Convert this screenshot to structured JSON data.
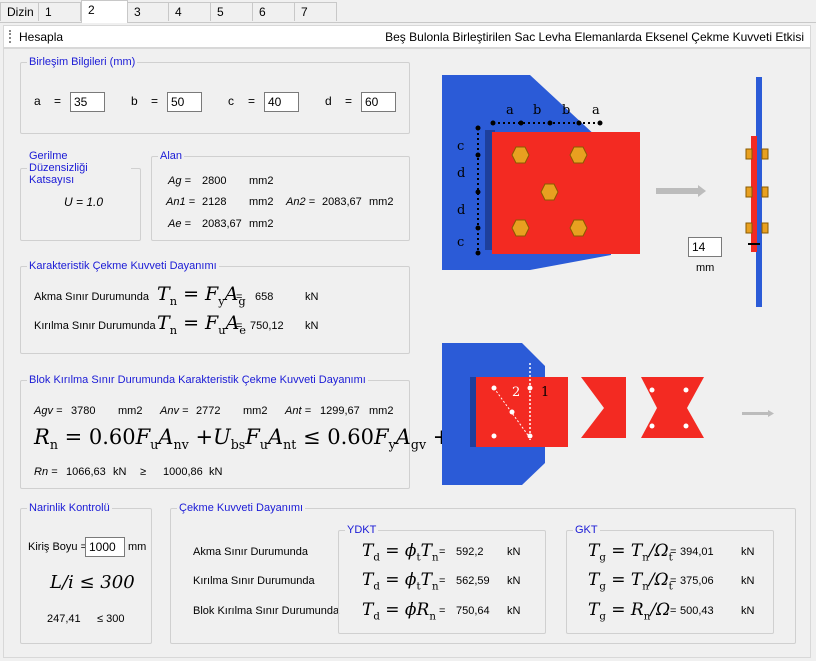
{
  "tabs": [
    "Dizin",
    "1",
    "2",
    "3",
    "4",
    "5",
    "6",
    "7"
  ],
  "toolbar": {
    "calc_label": "Hesapla",
    "title": "Beş Bulonla Birleştirilen Sac Levha Elemanlarda Eksenel Çekme Kuvveti Etkisi"
  },
  "connection": {
    "legend": "Birleşim Bilgileri (mm)",
    "a_label": "a",
    "a_value": "35",
    "b_label": "b",
    "b_value": "50",
    "c_label": "c",
    "c_value": "40",
    "d_label": "d",
    "d_value": "60",
    "eq": "="
  },
  "shearlag": {
    "legend": "Gerilme Düzensizliği Katsayısı",
    "u_text": "U = 1.0"
  },
  "area": {
    "legend": "Alan",
    "ag_label": "Ag =",
    "ag_value": "2800",
    "ag_unit": "mm2",
    "an1_label": "An1 =",
    "an1_value": "2128",
    "an1_unit": "mm2",
    "an2_label": "An2 =",
    "an2_value": "2083,67",
    "an2_unit": "mm2",
    "ae_label": "Ae =",
    "ae_value": "2083,67",
    "ae_unit": "mm2"
  },
  "nominal": {
    "legend": "Karakteristik Çekme Kuvveti Dayanımı",
    "yield_label": "Akma Sınır Durumunda",
    "yield_value": "658",
    "yield_unit": "kN",
    "rupture_label": "Kırılma Sınır Durumunda",
    "rupture_value": "750,12",
    "rupture_unit": "kN"
  },
  "block": {
    "legend": "Blok Kırılma Sınır Durumunda Karakteristik Çekme Kuvveti Dayanımı",
    "agv_label": "Agv =",
    "agv_value": "3780",
    "agv_unit": "mm2",
    "anv_label": "Anv =",
    "anv_value": "2772",
    "anv_unit": "mm2",
    "ant_label": "Ant =",
    "ant_value": "1299,67",
    "ant_unit": "mm2",
    "rn_label": "Rn =",
    "rn_value": "1066,63",
    "rn_unit": "kN",
    "ge": "≥",
    "limit_value": "1000,86",
    "limit_unit": "kN"
  },
  "slenderness": {
    "legend": "Narinlik Kontrolü",
    "length_label": "Kiriş Boyu =",
    "length_value": "1000",
    "length_unit": "mm",
    "ratio_value": "247,41",
    "ratio_limit": "≤ 300"
  },
  "design": {
    "legend": "Çekme Kuvveti Dayanımı",
    "ydkt_legend": "YDKT",
    "gkt_legend": "GKT",
    "row1": "Akma Sınır Durumunda",
    "row2": "Kırılma Sınır Durumunda",
    "row3": "Blok Kırılma Sınır Durumunda",
    "ydkt_v1": "592,2",
    "ydkt_v2": "562,59",
    "ydkt_v3": "750,64",
    "gkt_v1": "394,01",
    "gkt_v2": "375,06",
    "gkt_v3": "500,43",
    "unit": "kN"
  },
  "drawing": {
    "dim_a": "a",
    "dim_b": "b",
    "dim_c": "c",
    "dim_d": "d",
    "thickness_value": "14",
    "thickness_unit": "mm",
    "path1": "1",
    "path2": "2"
  },
  "colors": {
    "plate_blue": "#2b5bd7",
    "plate_red": "#f32a22",
    "bolt": "#e8a020",
    "legend_blue": "#1a1ad6"
  }
}
